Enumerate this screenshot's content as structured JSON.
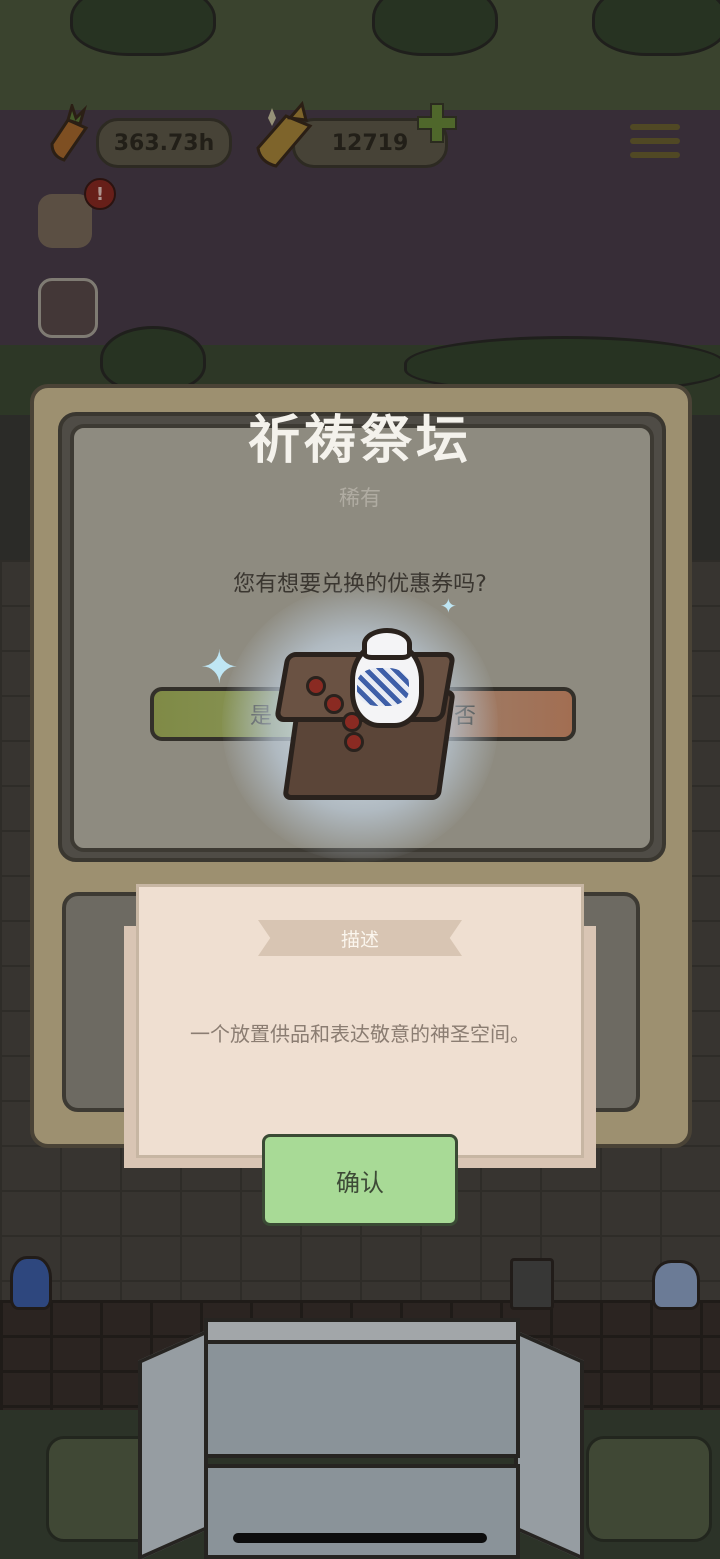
{
  "hud": {
    "carrots_value": "363.73h",
    "golden_carrots_value": "12719"
  },
  "dialog": {
    "title": "祈祷祭坛",
    "rarity": "稀有",
    "question": "您有想要兑换的优惠券吗?",
    "yes_label": "是",
    "no_label": "否"
  },
  "description": {
    "header": "描述",
    "text": "一个放置供品和表达敬意的神圣空间。",
    "confirm_label": "确认"
  },
  "colors": {
    "title": "#f4f2ec",
    "yes_button": "#8e9a60",
    "no_button": "#a26e52",
    "confirm_button": "#a8da96",
    "card": "#efdfd1"
  },
  "icons": [
    "carrot-icon",
    "golden-carrot-icon",
    "add-icon",
    "menu-icon",
    "shop-icon",
    "alert-badge-icon",
    "rabbit-icon",
    "sparkle-icon"
  ]
}
